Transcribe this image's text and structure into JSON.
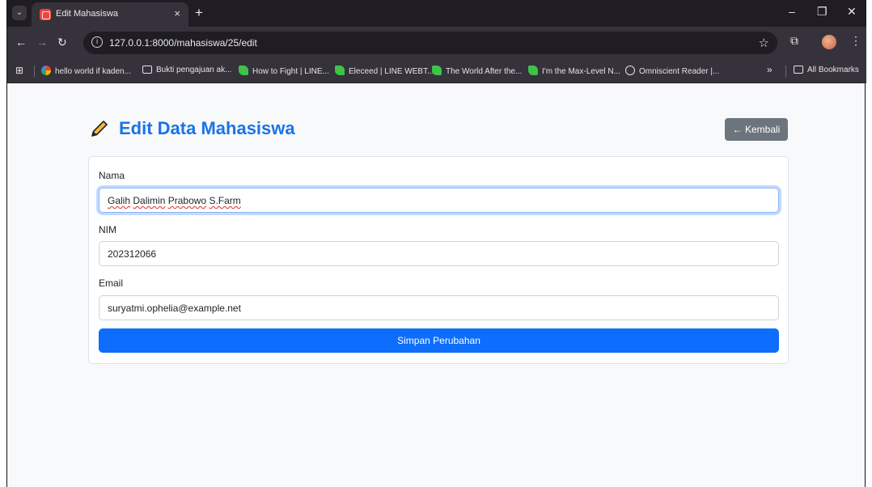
{
  "browser": {
    "tab_title": "Edit Mahasiswa",
    "tab_close": "×",
    "new_tab": "+",
    "url": "127.0.0.1:8000/mahasiswa/25/edit",
    "bookmarks": [
      {
        "label": "hello world if kaden...",
        "icon": "google-icon"
      },
      {
        "label": "Bukti pengajuan ak...",
        "icon": "folder-icon"
      },
      {
        "label": "How to Fight | LINE...",
        "icon": "line-webtoon-icon"
      },
      {
        "label": "Eleceed | LINE WEBT...",
        "icon": "line-webtoon-icon"
      },
      {
        "label": "The World After the...",
        "icon": "line-webtoon-icon"
      },
      {
        "label": "I'm the Max-Level N...",
        "icon": "line-webtoon-icon"
      },
      {
        "label": "Omniscient Reader |...",
        "icon": "globe-icon"
      }
    ],
    "bookmarks_overflow": "»",
    "all_bookmarks": "All Bookmarks"
  },
  "page": {
    "title": "Edit Data Mahasiswa",
    "back_button": "← Kembali",
    "form": {
      "nama_label": "Nama",
      "nama_value_words": [
        "Galih",
        "Dalimin",
        "Prabowo",
        "S.Farm"
      ],
      "nim_label": "NIM",
      "nim_value": "202312066",
      "email_label": "Email",
      "email_value": "suryatmi.ophelia@example.net",
      "submit_label": "Simpan Perubahan"
    }
  },
  "colors": {
    "accent": "#1a73e8",
    "primary_button": "#0d6efd",
    "secondary_button": "#6c757d"
  }
}
